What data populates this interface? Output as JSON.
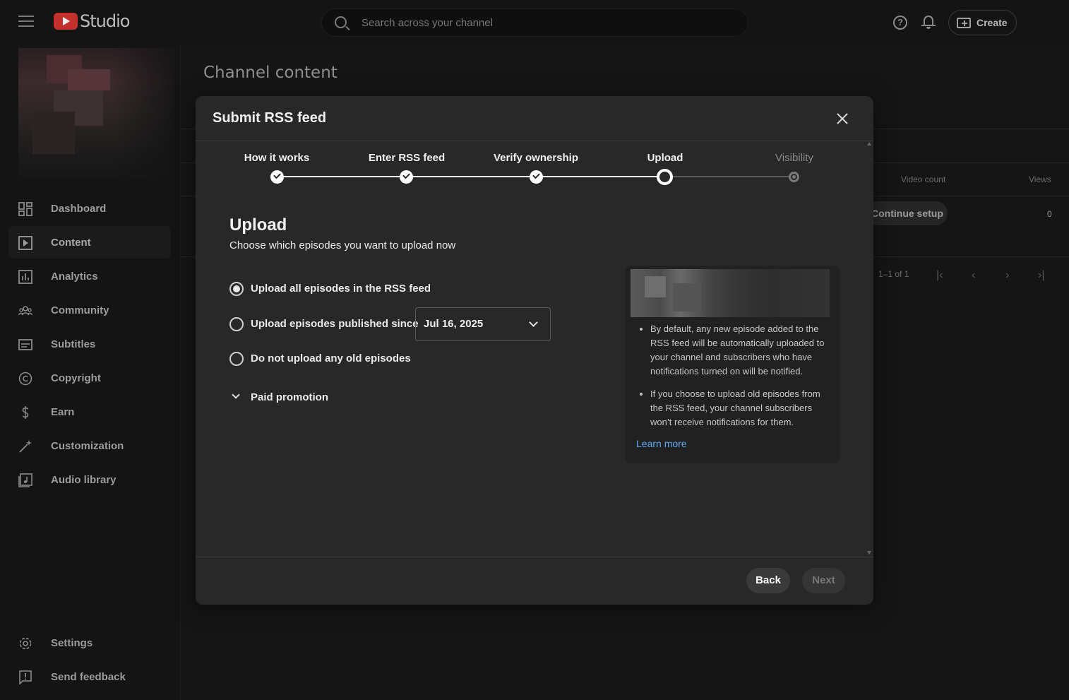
{
  "app": {
    "logo_text": "Studio"
  },
  "search": {
    "placeholder": "Search across your channel"
  },
  "header": {
    "create_label": "Create",
    "help_glyph": "?"
  },
  "sidebar": {
    "items": [
      {
        "label": "Dashboard",
        "icon": "dashboard-icon"
      },
      {
        "label": "Content",
        "icon": "content-icon"
      },
      {
        "label": "Analytics",
        "icon": "analytics-icon"
      },
      {
        "label": "Community",
        "icon": "community-icon"
      },
      {
        "label": "Subtitles",
        "icon": "subtitles-icon"
      },
      {
        "label": "Copyright",
        "icon": "copyright-icon"
      },
      {
        "label": "Earn",
        "icon": "earn-icon"
      },
      {
        "label": "Customization",
        "icon": "customization-icon"
      },
      {
        "label": "Audio library",
        "icon": "audio-library-icon"
      }
    ],
    "bottom": [
      {
        "label": "Settings",
        "icon": "gear-icon"
      },
      {
        "label": "Send feedback",
        "icon": "feedback-icon"
      }
    ]
  },
  "page": {
    "title": "Channel content",
    "table": {
      "col_video_count": "Video count",
      "col_views": "Views",
      "continue_label": "Continue setup",
      "views_value": "0",
      "pagination": "1–1 of 1"
    }
  },
  "modal": {
    "title": "Submit RSS feed",
    "steps": [
      {
        "label": "How it works",
        "state": "done"
      },
      {
        "label": "Enter RSS feed",
        "state": "done"
      },
      {
        "label": "Verify ownership",
        "state": "done"
      },
      {
        "label": "Upload",
        "state": "current"
      },
      {
        "label": "Visibility",
        "state": "todo"
      }
    ],
    "section_title": "Upload",
    "section_subtitle": "Choose which episodes you want to upload now",
    "options": [
      {
        "label": "Upload all episodes in the RSS feed",
        "checked": true
      },
      {
        "label": "Upload episodes published since",
        "checked": false
      },
      {
        "label": "Do not upload any old episodes",
        "checked": false
      }
    ],
    "date_value": "Jul 16, 2025",
    "paid_promotion_label": "Paid promotion",
    "info": {
      "bullets": [
        "By default, any new episode added to the RSS feed will be automatically uploaded to your channel and subscribers who have notifications turned on will be notified.",
        "If you choose to upload old episodes from the RSS feed, your channel subscribers won’t receive notifications for them."
      ],
      "learn_more": "Learn more"
    },
    "back_label": "Back",
    "next_label": "Next"
  }
}
